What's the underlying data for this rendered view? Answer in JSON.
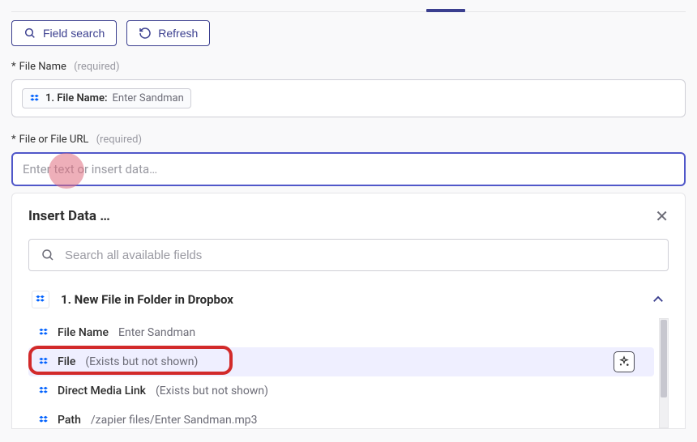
{
  "toolbar": {
    "field_search_label": "Field search",
    "refresh_label": "Refresh"
  },
  "fields": {
    "file_name": {
      "label": "File Name",
      "required_text": "(required)",
      "pill_prefix": "1. File Name:",
      "pill_value": "Enter Sandman"
    },
    "file_url": {
      "label": "File or File URL",
      "required_text": "(required)",
      "placeholder": "Enter text or insert data…"
    }
  },
  "insert_panel": {
    "title": "Insert Data …",
    "search_placeholder": "Search all available fields",
    "source_title": "1. New File in Folder in Dropbox",
    "items": [
      {
        "name": "File Name",
        "value": "Enter Sandman"
      },
      {
        "name": "File",
        "value": "(Exists but not shown)"
      },
      {
        "name": "Direct Media Link",
        "value": "(Exists but not shown)"
      },
      {
        "name": "Path",
        "value": "/zapier files/Enter Sandman.mp3"
      }
    ]
  }
}
